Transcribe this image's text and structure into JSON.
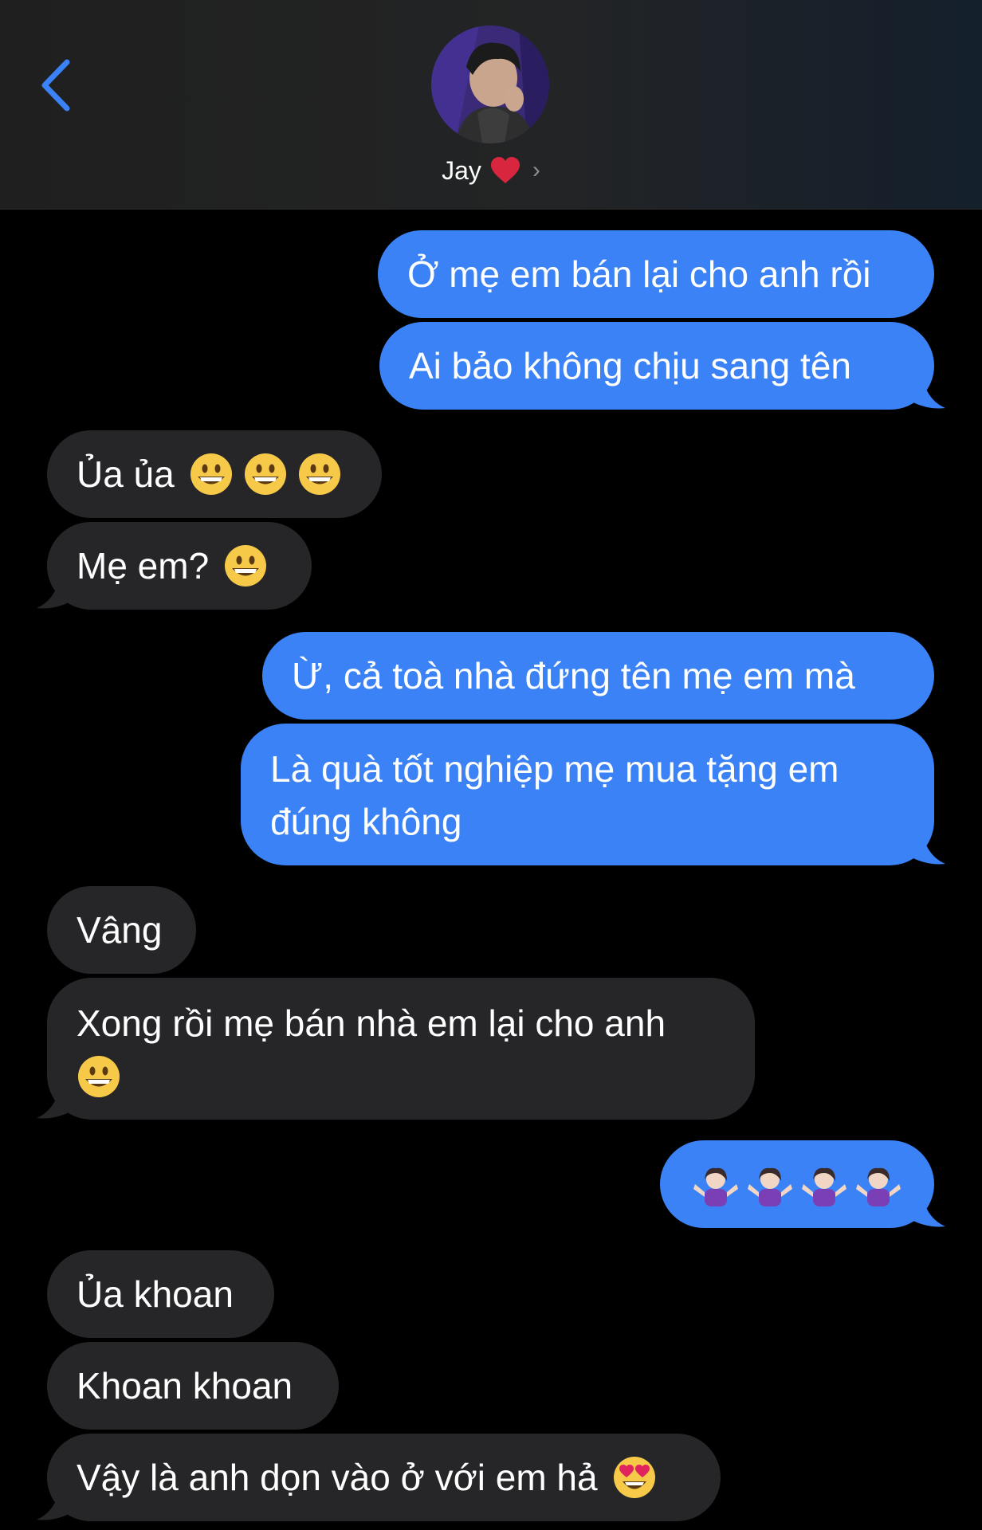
{
  "header": {
    "contact_name": "Jay",
    "heart_glyph": "❤️",
    "chevron": "›",
    "back_icon": "chevron-left-icon"
  },
  "colors": {
    "sent_bubble": "#3b82f6",
    "received_bubble": "#262628",
    "accent": "#3b82f6"
  },
  "messages": [
    {
      "from": "me",
      "text": "Ở mẹ em bán lại cho anh rồi"
    },
    {
      "from": "me",
      "text": "Ai bảo không chịu sang tên"
    },
    {
      "from": "them",
      "text": "Ủa ủa",
      "emojis": [
        "grinning-face",
        "grinning-face",
        "grinning-face"
      ]
    },
    {
      "from": "them",
      "text": "Mẹ em?",
      "emojis": [
        "grinning-face"
      ]
    },
    {
      "from": "me",
      "text": "Ừ, cả toà nhà đứng tên mẹ em mà"
    },
    {
      "from": "me",
      "text": "Là quà tốt nghiệp mẹ mua tặng em đúng không"
    },
    {
      "from": "them",
      "text": "Vâng"
    },
    {
      "from": "them",
      "text": "Xong rồi mẹ bán nhà em lại cho anh",
      "emojis": [
        "grinning-face"
      ]
    },
    {
      "from": "me",
      "text": "",
      "emojis": [
        "person-shrugging",
        "person-shrugging",
        "person-shrugging",
        "person-shrugging"
      ]
    },
    {
      "from": "them",
      "text": "Ủa khoan"
    },
    {
      "from": "them",
      "text": "Khoan khoan"
    },
    {
      "from": "them",
      "text": "Vậy là anh dọn vào ở với em hả",
      "emojis": [
        "heart-eyes-face"
      ]
    }
  ]
}
